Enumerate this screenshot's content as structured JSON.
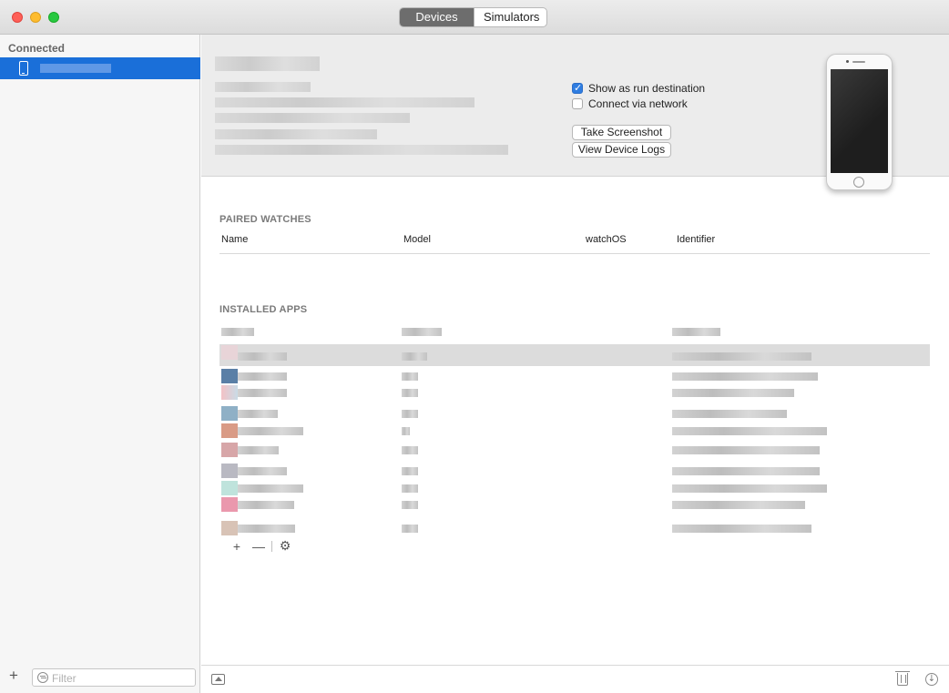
{
  "titlebar": {
    "tabs": [
      {
        "label": "Devices",
        "active": true
      },
      {
        "label": "Simulators",
        "active": false
      }
    ]
  },
  "sidebar": {
    "section_label": "Connected",
    "device_icon": "iphone-icon",
    "add_icon": "plus-icon",
    "filter_placeholder": "Filter",
    "filter_icon": "filter-icon"
  },
  "device": {
    "options": [
      {
        "label": "Show as run destination",
        "checked": true
      },
      {
        "label": "Connect via network",
        "checked": false
      }
    ],
    "buttons": {
      "take_screenshot": "Take Screenshot",
      "view_logs": "View Device Logs"
    }
  },
  "paired_watches": {
    "title": "PAIRED WATCHES",
    "columns": [
      "Name",
      "Model",
      "watchOS",
      "Identifier"
    ]
  },
  "installed_apps": {
    "title": "INSTALLED APPS",
    "tools": {
      "add": "+",
      "remove": "—",
      "settings_icon": "gear-icon"
    }
  },
  "bottom_bar": {
    "console_icon": "show-console-icon",
    "trash_icon": "trash-icon",
    "download_icon": "download-icon"
  },
  "colors": {
    "selection": "#1a6fd9",
    "checkbox_checked": "#2f7de1",
    "segment_active": "#6d6d6d"
  }
}
